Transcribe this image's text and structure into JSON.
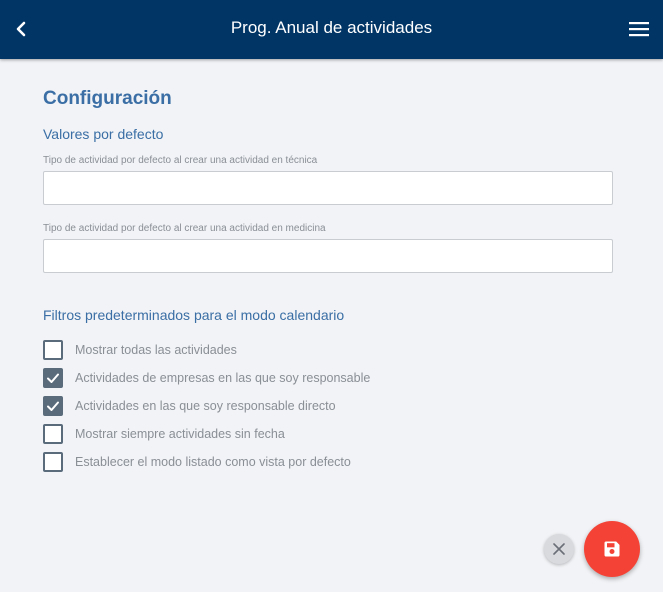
{
  "header": {
    "title": "Prog. Anual de actividades",
    "back_icon": "chevron-left-icon",
    "menu_icon": "hamburger-menu-icon"
  },
  "config": {
    "title": "Configuración",
    "defaults": {
      "title": "Valores por defecto",
      "fields": [
        {
          "label": "Tipo de actividad por defecto al crear una actividad en técnica",
          "value": ""
        },
        {
          "label": "Tipo de actividad por defecto al crear una actividad en medicina",
          "value": ""
        }
      ]
    },
    "filters": {
      "title": "Filtros predeterminados para el modo calendario",
      "items": [
        {
          "label": "Mostrar todas las actividades",
          "checked": false
        },
        {
          "label": "Actividades de empresas en las que soy responsable",
          "checked": true
        },
        {
          "label": "Actividades en las que soy responsable directo",
          "checked": true
        },
        {
          "label": "Mostrar siempre actividades sin fecha",
          "checked": false
        },
        {
          "label": "Establecer el modo listado como vista por defecto",
          "checked": false
        }
      ]
    }
  },
  "actions": {
    "cancel_icon": "close-icon",
    "save_icon": "floppy-disk-icon"
  },
  "colors": {
    "header_bg": "#003566",
    "accent": "#3a6ea5",
    "save_fab": "#f44336",
    "checkbox": "#5a6b7c"
  }
}
